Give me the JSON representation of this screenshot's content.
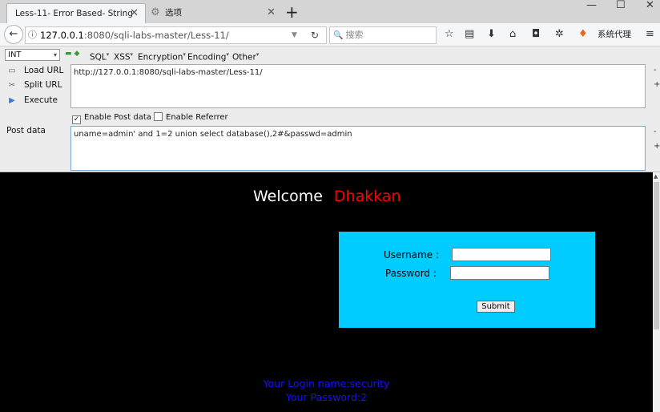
{
  "tabs": {
    "active_title": "Less-11- Error Based- String",
    "inactive_title": "选项",
    "close_glyph": "✕"
  },
  "window": {
    "minimize": "—",
    "maximize": "☐",
    "close": "✕"
  },
  "nav": {
    "url_host": "127.0.0.1",
    "url_rest": ":8080/sqli-labs-master/Less-11/",
    "search_placeholder": "搜索",
    "proxy_label": "系统代理"
  },
  "hackbar": {
    "select_value": "INT",
    "menus": [
      "SQL",
      "XSS",
      "Encryption",
      "Encoding",
      "Other"
    ],
    "load_url": "Load URL",
    "split_url": "Split URL",
    "execute": "Execute",
    "url_value": "http://127.0.0.1:8080/sqli-labs-master/Less-11/",
    "enable_post": "Enable Post data",
    "enable_post_checked": true,
    "enable_referrer": "Enable Referrer",
    "enable_referrer_checked": false,
    "post_label": "Post data",
    "post_value": "uname=admin' and 1=2 union select database(),2#&passwd=admin"
  },
  "page": {
    "welcome": "Welcome",
    "username_highlight": "Dhakkan",
    "username_label": "Username :",
    "password_label": "Password :",
    "submit_label": "Submit",
    "result_login": "Your Login name:security",
    "result_password": "Your Password:2"
  },
  "colors": {
    "login_box": "#00ccff",
    "highlight_red": "#ff0000",
    "result_blue": "#1212ff",
    "page_bg": "#000000"
  }
}
